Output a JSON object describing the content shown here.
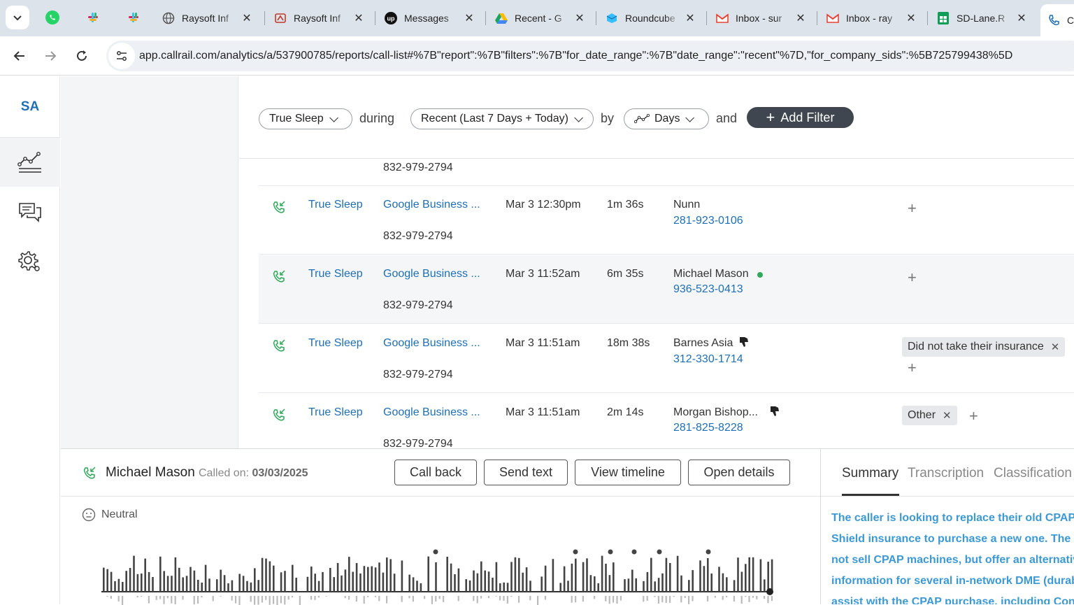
{
  "browser": {
    "tabs": [
      {
        "label": "Raysoft Inf",
        "icon": "globe-icon"
      },
      {
        "label": "Raysoft Inf",
        "icon": "raysoft-icon"
      },
      {
        "label": "Messages",
        "icon": "upwork-icon"
      },
      {
        "label": "Recent - G",
        "icon": "google-drive-icon"
      },
      {
        "label": "Roundcube",
        "icon": "roundcube-icon"
      },
      {
        "label": "Inbox - sur",
        "icon": "gmail-icon"
      },
      {
        "label": "Inbox - ray",
        "icon": "gmail-icon"
      },
      {
        "label": "SD-Lane.R",
        "icon": "sheets-icon"
      },
      {
        "label": "C",
        "icon": "callrail-icon"
      }
    ],
    "url_host": "app.callrail.com",
    "url_path": "/analytics/a/537900785/reports/call-list#%7B\"report\":%7B\"filters\":%7B\"for_date_range\":%7B\"date_range\":\"recent\"%7D,\"for_company_sids\":%5B725799438%5D"
  },
  "nav": {
    "avatar": "SA"
  },
  "filters": {
    "company": "True Sleep",
    "during": "during",
    "date_range": "Recent (Last 7 Days + Today)",
    "by": "by",
    "grouping": "Days",
    "and": "and",
    "add_filter": "Add Filter"
  },
  "calls": {
    "partial_number": "832-979-2794",
    "rows": [
      {
        "company": "True Sleep",
        "source": "Google Business ...",
        "tracking_number": "832-979-2794",
        "datetime": "Mar 3 12:30pm",
        "duration": "1m 36s",
        "caller": "Nunn",
        "caller_number": "281-923-0106",
        "tags": []
      },
      {
        "company": "True Sleep",
        "source": "Google Business ...",
        "tracking_number": "832-979-2794",
        "datetime": "Mar 3 11:52am",
        "duration": "6m 35s",
        "caller": "Michael Mason",
        "caller_number": "936-523-0413",
        "tags": []
      },
      {
        "company": "True Sleep",
        "source": "Google Business ...",
        "tracking_number": "832-979-2794",
        "datetime": "Mar 3 11:51am",
        "duration": "18m 38s",
        "caller": "Barnes Asia",
        "caller_number": "312-330-1714",
        "tags": [
          "Did not take their insurance"
        ]
      },
      {
        "company": "True Sleep",
        "source": "Google Business ...",
        "tracking_number": "832-979-2794",
        "datetime": "Mar 3 11:51am",
        "duration": "2m 14s",
        "caller": "Morgan Bishop...",
        "caller_number": "281-825-8228",
        "tags": [
          "Other"
        ]
      }
    ]
  },
  "detail": {
    "name": "Michael Mason",
    "called_on_label": "Called on:",
    "called_on_date": "03/03/2025",
    "buttons": {
      "call_back": "Call back",
      "send_text": "Send text",
      "view_timeline": "View timeline",
      "open_details": "Open details"
    },
    "sentiment": "Neutral"
  },
  "side": {
    "tabs": {
      "summary": "Summary",
      "transcription": "Transcription",
      "classification": "Classification"
    },
    "summary_lines": [
      "The caller is looking to replace their old CPAP m",
      "Shield insurance to purchase a new one. The re",
      "not sell CPAP machines, but offer an alternative",
      "information for several in-network DME (durab",
      "assist with the CPAP purchase, including Conc"
    ]
  },
  "colors": {
    "link": "#1d6fb8",
    "call_icon": "#2eaa58",
    "summary_text": "#3b9ad6",
    "add_filter_bg": "#3f4650"
  }
}
